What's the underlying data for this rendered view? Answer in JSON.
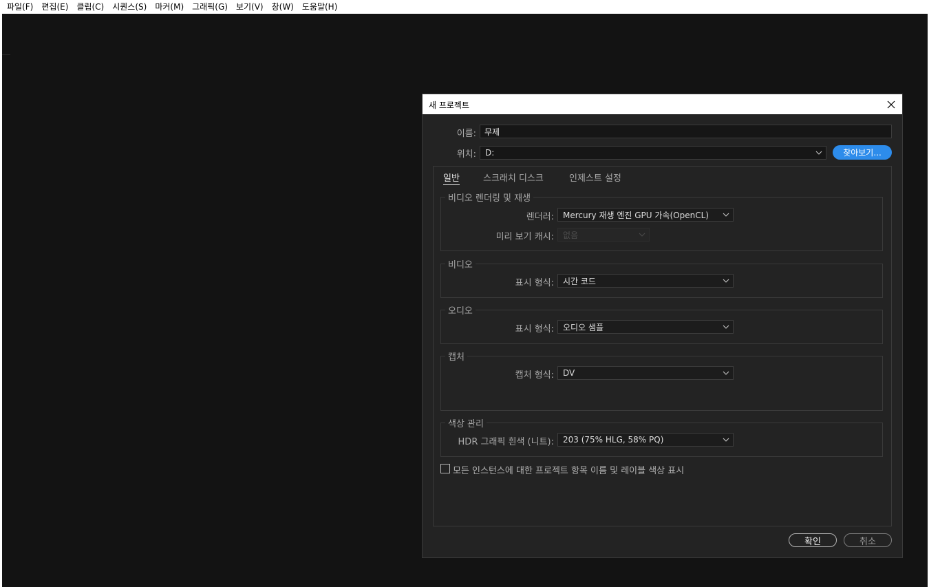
{
  "menubar": {
    "items": [
      "파일(F)",
      "편집(E)",
      "클립(C)",
      "시퀀스(S)",
      "마커(M)",
      "그래픽(G)",
      "보기(V)",
      "창(W)",
      "도움말(H)"
    ]
  },
  "dialog": {
    "title": "새 프로젝트",
    "name_label": "이름:",
    "name_value": "무제",
    "location_label": "위치:",
    "location_value": "D:",
    "browse_label": "찾아보기...",
    "tabs": [
      {
        "label": "일반",
        "active": true
      },
      {
        "label": "스크래치 디스크",
        "active": false
      },
      {
        "label": "인제스트 설정",
        "active": false
      }
    ],
    "groups": {
      "render": {
        "title": "비디오 렌더링 및 재생",
        "renderer_label": "렌더러:",
        "renderer_value": "Mercury 재생 엔진 GPU 가속(OpenCL)",
        "preview_cache_label": "미리 보기 캐시:",
        "preview_cache_value": "없음"
      },
      "video": {
        "title": "비디오",
        "display_label": "표시 형식:",
        "display_value": "시간 코드"
      },
      "audio": {
        "title": "오디오",
        "display_label": "표시 형식:",
        "display_value": "오디오 샘플"
      },
      "capture": {
        "title": "캡처",
        "format_label": "캡처 형식:",
        "format_value": "DV"
      },
      "color": {
        "title": "색상 관리",
        "hdr_label": "HDR 그래픽 흰색 (니트):",
        "hdr_value": "203 (75% HLG, 58% PQ)"
      }
    },
    "checkbox_label": "모든 인스턴스에 대한 프로젝트 항목 이름 및 레이블 색상 표시",
    "checkbox_checked": false,
    "ok_label": "확인",
    "cancel_label": "취소"
  },
  "colors": {
    "accent": "#2d8ceb",
    "workspace": "#131313",
    "dialog_bg": "#232323"
  }
}
